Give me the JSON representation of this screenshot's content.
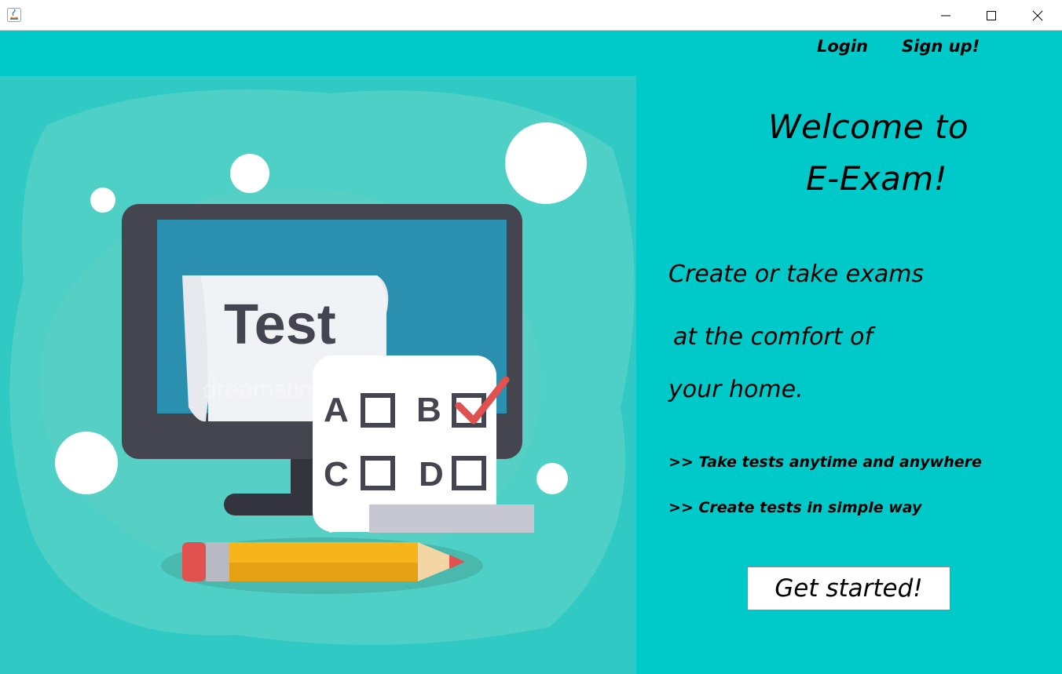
{
  "window": {
    "controls": {
      "minimize": "minimize-icon",
      "maximize": "maximize-icon",
      "close": "close-icon"
    }
  },
  "nav": {
    "login": "Login",
    "signup": "Sign up!"
  },
  "welcome": {
    "line1": "Welcome to",
    "line2": "E-Exam!"
  },
  "tagline": {
    "line1": "Create or take exams",
    "line2": "at the comfort of",
    "line3": "your home."
  },
  "features": [
    ">> Take tests anytime and anywhere",
    ">> Create tests in simple way"
  ],
  "cta": {
    "label": "Get started!"
  },
  "illustration": {
    "title": "Test",
    "options": [
      "A",
      "B",
      "C",
      "D"
    ],
    "checked_option": "B",
    "watermark": "dreamstime"
  },
  "colors": {
    "background": "#00c9c9",
    "accent": "#e0514f",
    "monitor": "#3a3c47",
    "screen": "#2b8fb0",
    "pencil": "#f6b51a"
  }
}
